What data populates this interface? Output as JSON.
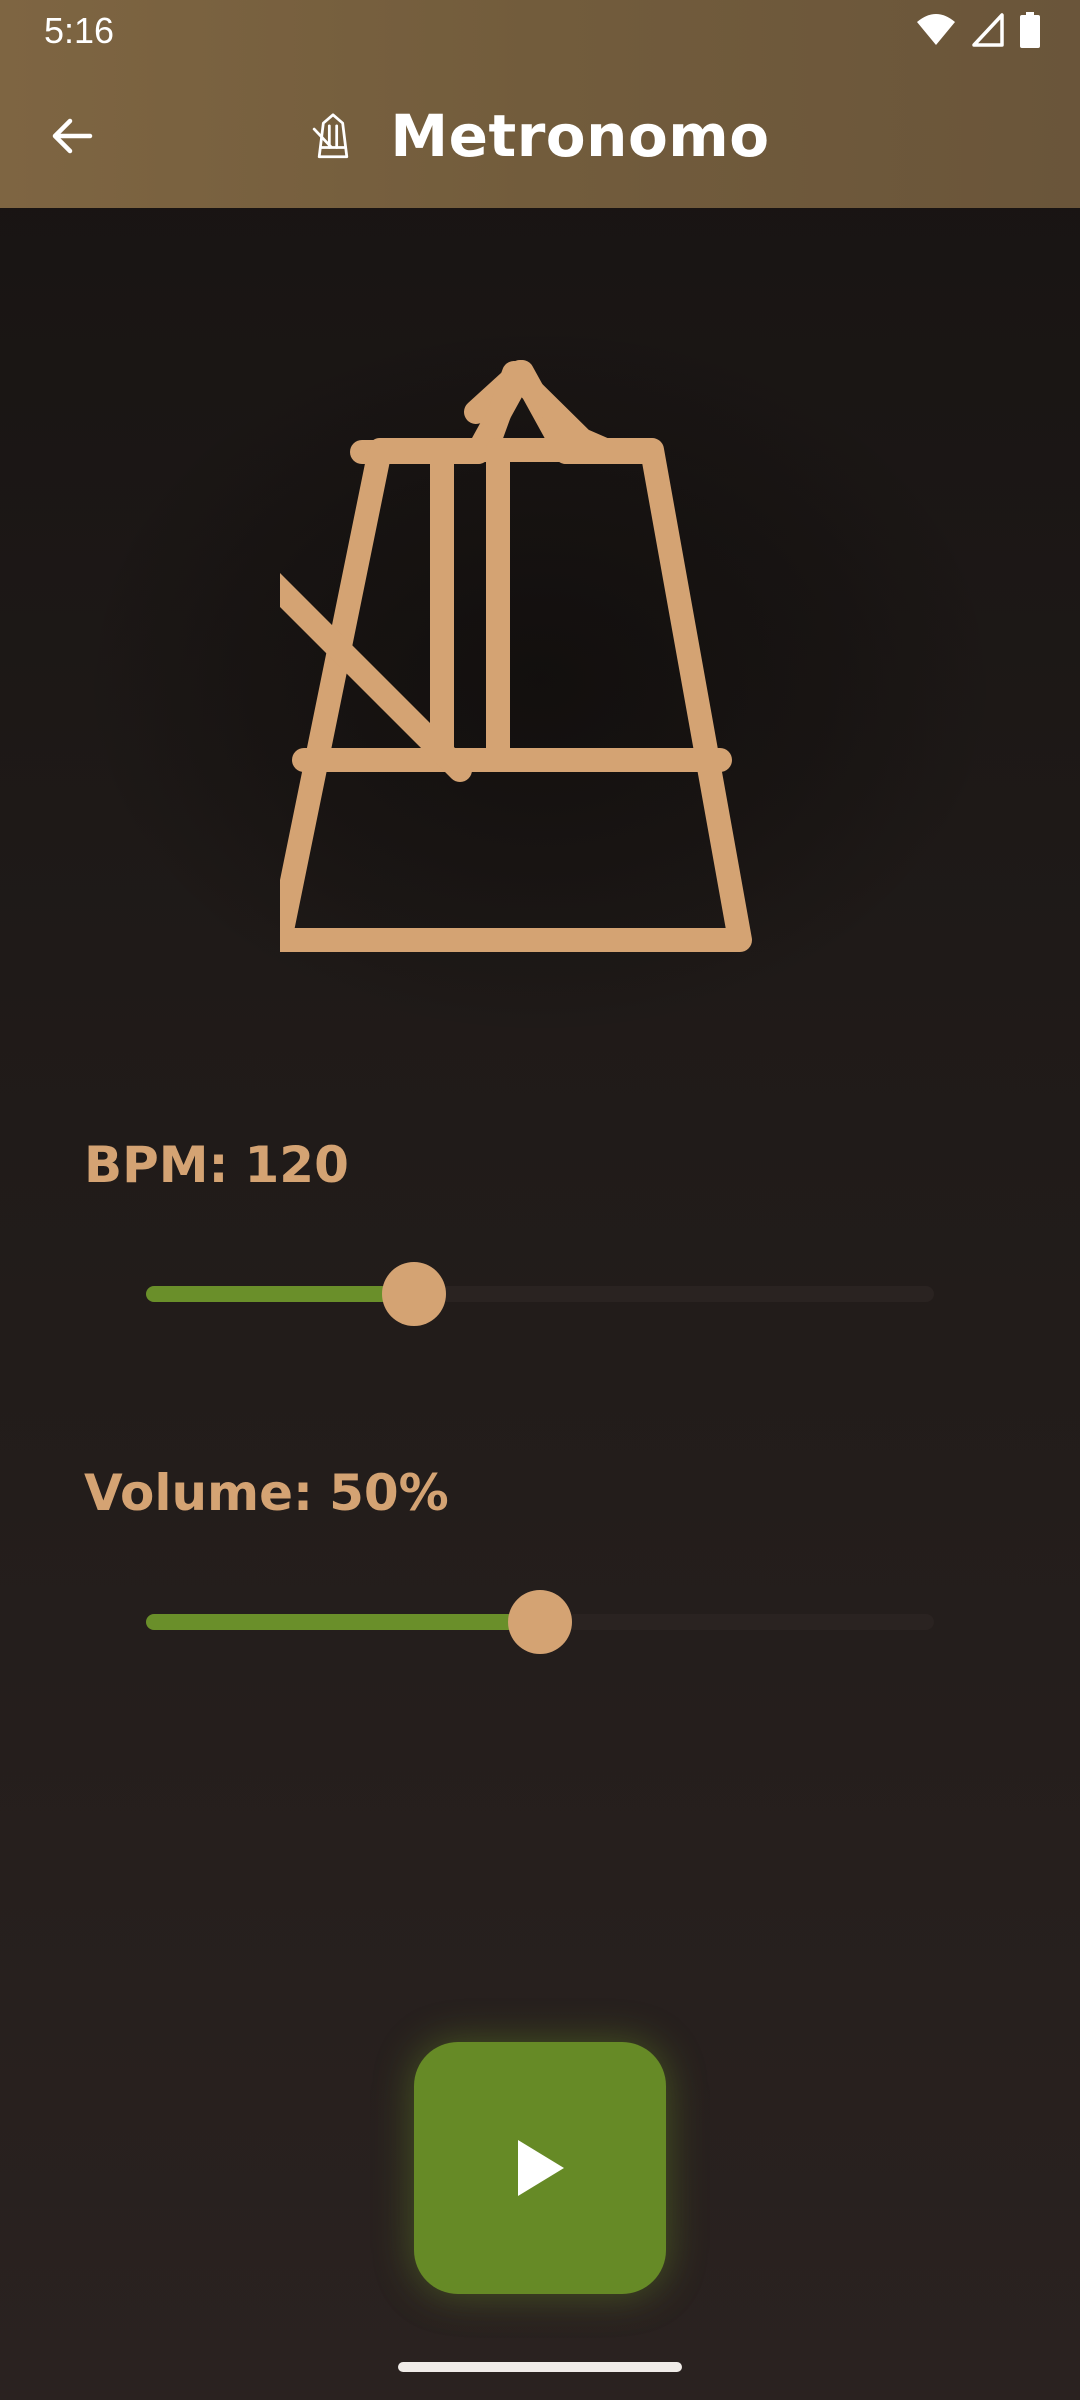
{
  "status_bar": {
    "time": "5:16",
    "icons": [
      "wifi-icon",
      "cellular-signal-icon",
      "battery-icon"
    ]
  },
  "app_bar": {
    "title": "Metronomo",
    "back_icon": "arrow-left-icon",
    "title_icon": "metronome-icon"
  },
  "hero": {
    "icon": "metronome-icon"
  },
  "bpm": {
    "label": "BPM:",
    "value": "120",
    "fraction": 0.34
  },
  "volume": {
    "label": "Volume:",
    "value": "50%",
    "fraction": 0.5
  },
  "play": {
    "icon": "play-icon"
  },
  "colors": {
    "accent": "#d4a373",
    "slider_active": "#6a8f2a",
    "play_button": "#668a26",
    "app_bar": "#7a6240",
    "background": "#1d1917"
  }
}
